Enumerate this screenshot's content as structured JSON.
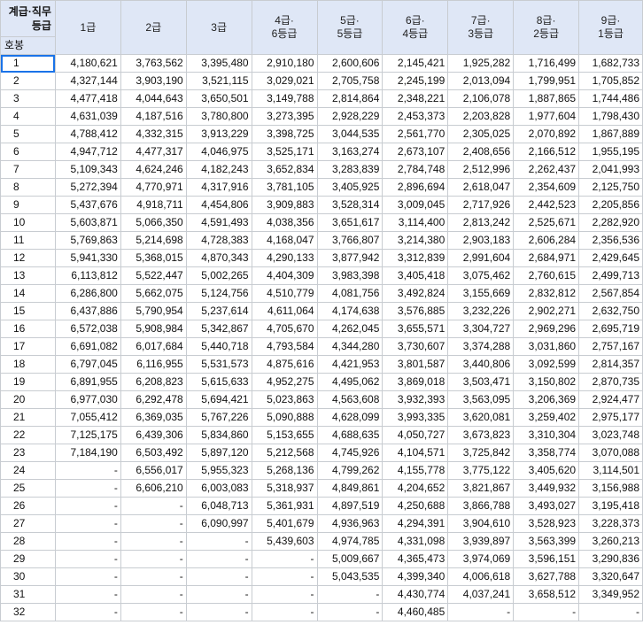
{
  "corner": {
    "top": "계급·직무",
    "mid": "등급",
    "bottom": "호봉"
  },
  "columns": [
    {
      "line1": "1급",
      "line2": ""
    },
    {
      "line1": "2급",
      "line2": ""
    },
    {
      "line1": "3급",
      "line2": ""
    },
    {
      "line1": "4급·",
      "line2": "6등급"
    },
    {
      "line1": "5급·",
      "line2": "5등급"
    },
    {
      "line1": "6급·",
      "line2": "4등급"
    },
    {
      "line1": "7급·",
      "line2": "3등급"
    },
    {
      "line1": "8급·",
      "line2": "2등급"
    },
    {
      "line1": "9급·",
      "line2": "1등급"
    }
  ],
  "rows": [
    {
      "step": "1",
      "values": [
        "4,180,621",
        "3,763,562",
        "3,395,480",
        "2,910,180",
        "2,600,606",
        "2,145,421",
        "1,925,282",
        "1,716,499",
        "1,682,733"
      ]
    },
    {
      "step": "2",
      "values": [
        "4,327,144",
        "3,903,190",
        "3,521,115",
        "3,029,021",
        "2,705,758",
        "2,245,199",
        "2,013,094",
        "1,799,951",
        "1,705,852"
      ]
    },
    {
      "step": "3",
      "values": [
        "4,477,418",
        "4,044,643",
        "3,650,501",
        "3,149,788",
        "2,814,864",
        "2,348,221",
        "2,106,078",
        "1,887,865",
        "1,744,486"
      ]
    },
    {
      "step": "4",
      "values": [
        "4,631,039",
        "4,187,516",
        "3,780,800",
        "3,273,395",
        "2,928,229",
        "2,453,373",
        "2,203,828",
        "1,977,604",
        "1,798,430"
      ]
    },
    {
      "step": "5",
      "values": [
        "4,788,412",
        "4,332,315",
        "3,913,229",
        "3,398,725",
        "3,044,535",
        "2,561,770",
        "2,305,025",
        "2,070,892",
        "1,867,889"
      ]
    },
    {
      "step": "6",
      "values": [
        "4,947,712",
        "4,477,317",
        "4,046,975",
        "3,525,171",
        "3,163,274",
        "2,673,107",
        "2,408,656",
        "2,166,512",
        "1,955,195"
      ]
    },
    {
      "step": "7",
      "values": [
        "5,109,343",
        "4,624,246",
        "4,182,243",
        "3,652,834",
        "3,283,839",
        "2,784,748",
        "2,512,996",
        "2,262,437",
        "2,041,993"
      ]
    },
    {
      "step": "8",
      "values": [
        "5,272,394",
        "4,770,971",
        "4,317,916",
        "3,781,105",
        "3,405,925",
        "2,896,694",
        "2,618,047",
        "2,354,609",
        "2,125,750"
      ]
    },
    {
      "step": "9",
      "values": [
        "5,437,676",
        "4,918,711",
        "4,454,806",
        "3,909,883",
        "3,528,314",
        "3,009,045",
        "2,717,926",
        "2,442,523",
        "2,205,856"
      ]
    },
    {
      "step": "10",
      "values": [
        "5,603,871",
        "5,066,350",
        "4,591,493",
        "4,038,356",
        "3,651,617",
        "3,114,400",
        "2,813,242",
        "2,525,671",
        "2,282,920"
      ]
    },
    {
      "step": "11",
      "values": [
        "5,769,863",
        "5,214,698",
        "4,728,383",
        "4,168,047",
        "3,766,807",
        "3,214,380",
        "2,903,183",
        "2,606,284",
        "2,356,536"
      ]
    },
    {
      "step": "12",
      "values": [
        "5,941,330",
        "5,368,015",
        "4,870,343",
        "4,290,133",
        "3,877,942",
        "3,312,839",
        "2,991,604",
        "2,684,971",
        "2,429,645"
      ]
    },
    {
      "step": "13",
      "values": [
        "6,113,812",
        "5,522,447",
        "5,002,265",
        "4,404,309",
        "3,983,398",
        "3,405,418",
        "3,075,462",
        "2,760,615",
        "2,499,713"
      ]
    },
    {
      "step": "14",
      "values": [
        "6,286,800",
        "5,662,075",
        "5,124,756",
        "4,510,779",
        "4,081,756",
        "3,492,824",
        "3,155,669",
        "2,832,812",
        "2,567,854"
      ]
    },
    {
      "step": "15",
      "values": [
        "6,437,886",
        "5,790,954",
        "5,237,614",
        "4,611,064",
        "4,174,638",
        "3,576,885",
        "3,232,226",
        "2,902,271",
        "2,632,750"
      ]
    },
    {
      "step": "16",
      "values": [
        "6,572,038",
        "5,908,984",
        "5,342,867",
        "4,705,670",
        "4,262,045",
        "3,655,571",
        "3,304,727",
        "2,969,296",
        "2,695,719"
      ]
    },
    {
      "step": "17",
      "values": [
        "6,691,082",
        "6,017,684",
        "5,440,718",
        "4,793,584",
        "4,344,280",
        "3,730,607",
        "3,374,288",
        "3,031,860",
        "2,757,167"
      ]
    },
    {
      "step": "18",
      "values": [
        "6,797,045",
        "6,116,955",
        "5,531,573",
        "4,875,616",
        "4,421,953",
        "3,801,587",
        "3,440,806",
        "3,092,599",
        "2,814,357"
      ]
    },
    {
      "step": "19",
      "values": [
        "6,891,955",
        "6,208,823",
        "5,615,633",
        "4,952,275",
        "4,495,062",
        "3,869,018",
        "3,503,471",
        "3,150,802",
        "2,870,735"
      ]
    },
    {
      "step": "20",
      "values": [
        "6,977,030",
        "6,292,478",
        "5,694,421",
        "5,023,863",
        "4,563,608",
        "3,932,393",
        "3,563,095",
        "3,206,369",
        "2,924,477"
      ]
    },
    {
      "step": "21",
      "values": [
        "7,055,412",
        "6,369,035",
        "5,767,226",
        "5,090,888",
        "4,628,099",
        "3,993,335",
        "3,620,081",
        "3,259,402",
        "2,975,177"
      ]
    },
    {
      "step": "22",
      "values": [
        "7,125,175",
        "6,439,306",
        "5,834,860",
        "5,153,655",
        "4,688,635",
        "4,050,727",
        "3,673,823",
        "3,310,304",
        "3,023,748"
      ]
    },
    {
      "step": "23",
      "values": [
        "7,184,190",
        "6,503,492",
        "5,897,120",
        "5,212,568",
        "4,745,926",
        "4,104,571",
        "3,725,842",
        "3,358,774",
        "3,070,088"
      ]
    },
    {
      "step": "24",
      "values": [
        "-",
        "6,556,017",
        "5,955,323",
        "5,268,136",
        "4,799,262",
        "4,155,778",
        "3,775,122",
        "3,405,620",
        "3,114,501"
      ]
    },
    {
      "step": "25",
      "values": [
        "-",
        "6,606,210",
        "6,003,083",
        "5,318,937",
        "4,849,861",
        "4,204,652",
        "3,821,867",
        "3,449,932",
        "3,156,988"
      ]
    },
    {
      "step": "26",
      "values": [
        "-",
        "-",
        "6,048,713",
        "5,361,931",
        "4,897,519",
        "4,250,688",
        "3,866,788",
        "3,493,027",
        "3,195,418"
      ]
    },
    {
      "step": "27",
      "values": [
        "-",
        "-",
        "6,090,997",
        "5,401,679",
        "4,936,963",
        "4,294,391",
        "3,904,610",
        "3,528,923",
        "3,228,373"
      ]
    },
    {
      "step": "28",
      "values": [
        "-",
        "-",
        "-",
        "5,439,603",
        "4,974,785",
        "4,331,098",
        "3,939,897",
        "3,563,399",
        "3,260,213"
      ]
    },
    {
      "step": "29",
      "values": [
        "-",
        "-",
        "-",
        "-",
        "5,009,667",
        "4,365,473",
        "3,974,069",
        "3,596,151",
        "3,290,836"
      ]
    },
    {
      "step": "30",
      "values": [
        "-",
        "-",
        "-",
        "-",
        "5,043,535",
        "4,399,340",
        "4,006,618",
        "3,627,788",
        "3,320,647"
      ]
    },
    {
      "step": "31",
      "values": [
        "-",
        "-",
        "-",
        "-",
        "-",
        "4,430,774",
        "4,037,241",
        "3,658,512",
        "3,349,952"
      ]
    },
    {
      "step": "32",
      "values": [
        "-",
        "-",
        "-",
        "-",
        "-",
        "4,460,485",
        "-",
        "-",
        "-"
      ]
    }
  ]
}
